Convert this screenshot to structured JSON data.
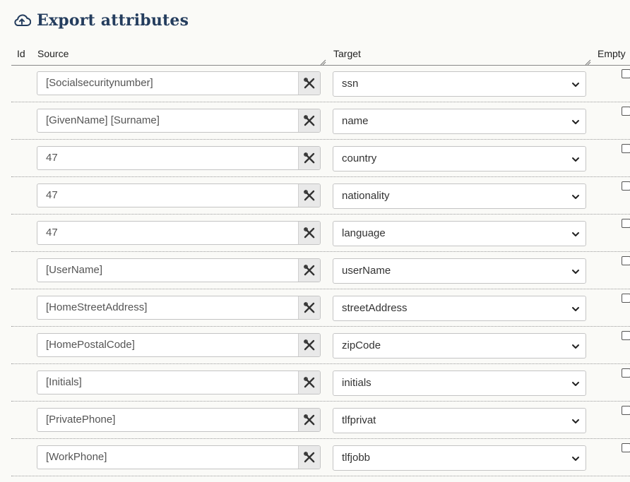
{
  "title": "Export attributes",
  "columns": {
    "id": "Id",
    "source": "Source",
    "target": "Target",
    "empty": "Empty"
  },
  "rows": [
    {
      "source": "[Socialsecuritynumber]",
      "target": "ssn"
    },
    {
      "source": "[GivenName] [Surname]",
      "target": "name"
    },
    {
      "source": "47",
      "target": "country"
    },
    {
      "source": "47",
      "target": "nationality"
    },
    {
      "source": "47",
      "target": "language"
    },
    {
      "source": "[UserName]",
      "target": "userName"
    },
    {
      "source": "[HomeStreetAddress]",
      "target": "streetAddress"
    },
    {
      "source": "[HomePostalCode]",
      "target": "zipCode"
    },
    {
      "source": "[Initials]",
      "target": "initials"
    },
    {
      "source": "[PrivatePhone]",
      "target": "tlfprivat"
    },
    {
      "source": "[WorkPhone]",
      "target": "tlfjobb"
    }
  ],
  "icons": {
    "title": "cloud-upload-icon",
    "source_button": "tools-icon",
    "target_dropdown": "chevron-down-icon"
  },
  "colors": {
    "title": "#243d5e",
    "background": "#fafaf7"
  }
}
